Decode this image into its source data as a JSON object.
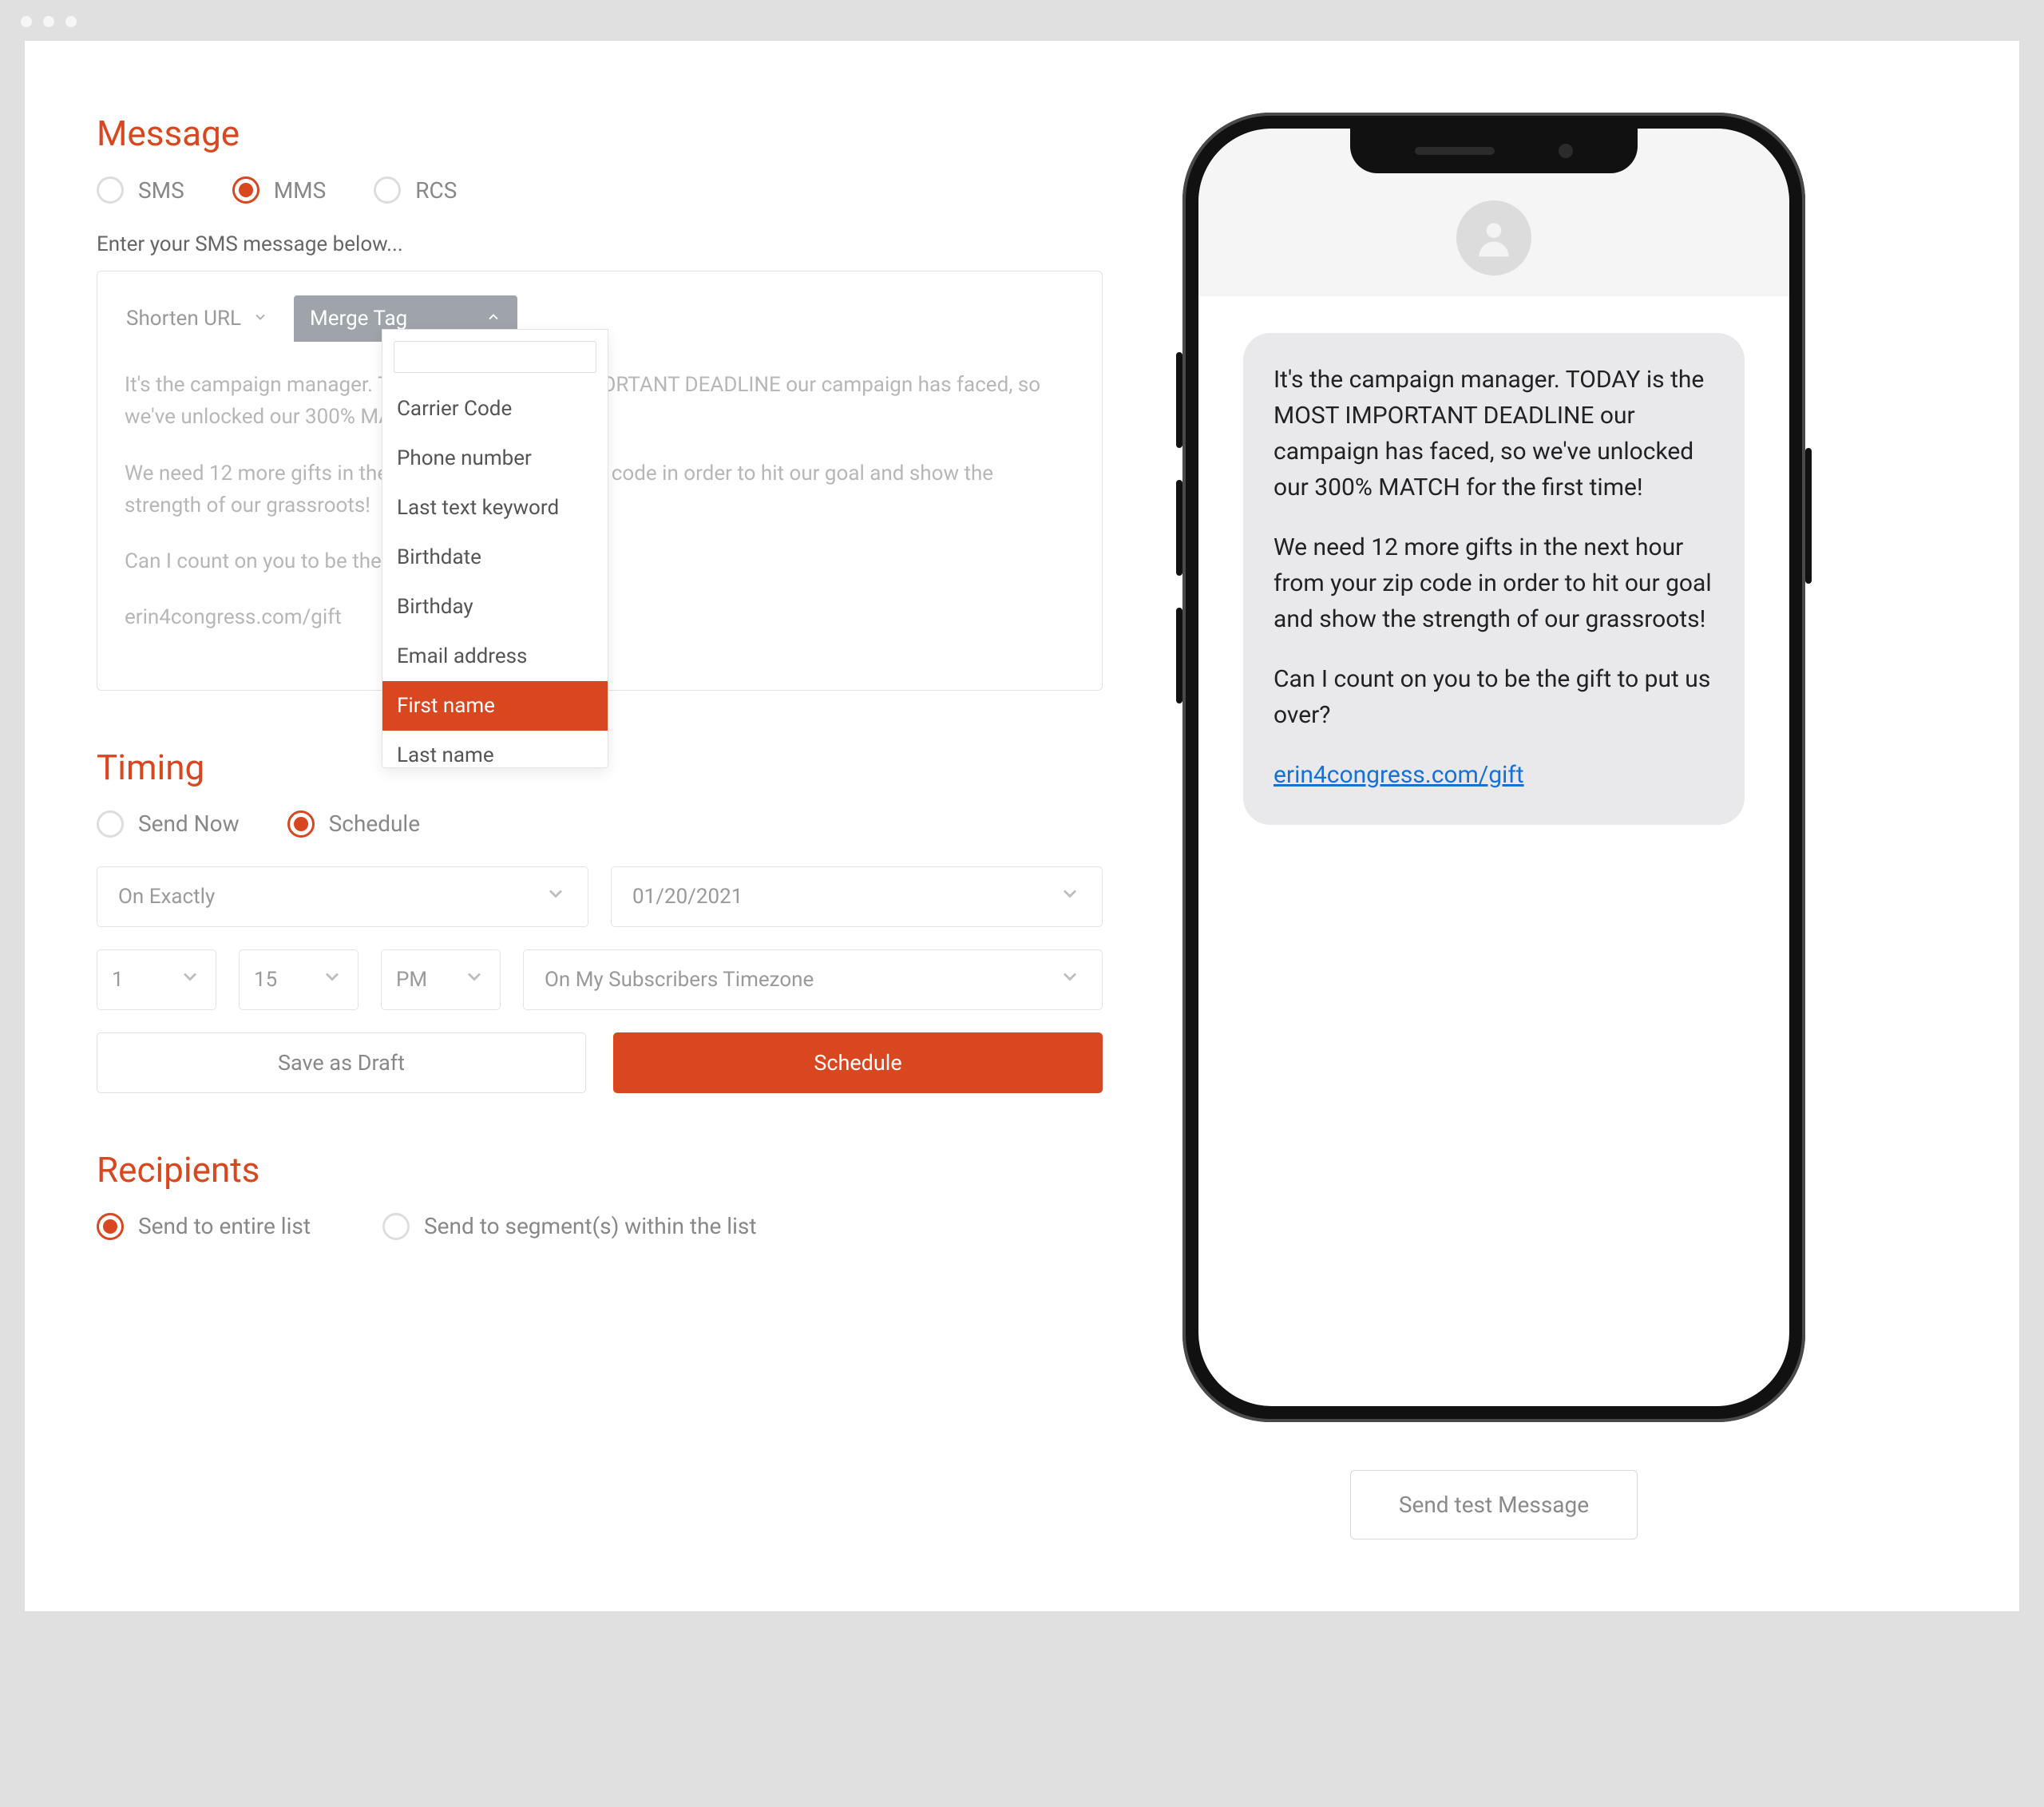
{
  "sections": {
    "message": "Message",
    "timing": "Timing",
    "recipients": "Recipients"
  },
  "message_type": {
    "options": {
      "sms": "SMS",
      "mms": "MMS",
      "rcs": "RCS"
    },
    "selected": "mms"
  },
  "compose": {
    "hint": "Enter your SMS message below...",
    "shorten_url_label": "Shorten URL",
    "merge_tag_label": "Merge Tag",
    "body": {
      "p1": "It's the campaign manager. TODAY is the MOST IMPORTANT DEADLINE our campaign has faced, so we've unlocked our 300% MATCH for the first time!",
      "p2": "We need 12 more gifts in the next hour from your zip code in order to hit our goal and show the strength of our grassroots!",
      "p3": "Can I count on you to be the gift to put us over?",
      "link_text": "erin4congress.com/gift"
    },
    "merge_tags": {
      "search_value": "",
      "options": [
        "Carrier Code",
        "Phone number",
        "Last text keyword",
        "Birthdate",
        "Birthday",
        "Email address",
        "First name",
        "Last name"
      ],
      "highlighted_index": 6
    }
  },
  "timing": {
    "options": {
      "now": "Send Now",
      "schedule": "Schedule"
    },
    "selected": "schedule",
    "mode": "On Exactly",
    "date": "01/20/2021",
    "hour": "1",
    "minute": "15",
    "ampm": "PM",
    "tz": "On My Subscribers Timezone",
    "save_draft": "Save as Draft",
    "schedule_btn": "Schedule"
  },
  "recipients": {
    "options": {
      "all": "Send to entire list",
      "segment": "Send to segment(s) within the list"
    },
    "selected": "all"
  },
  "preview": {
    "p1": "It's the campaign manager. TODAY is the MOST IMPORTANT DEADLINE our campaign has faced, so we've unlocked our 300% MATCH for the first time!",
    "p2": "We need 12 more gifts in the next hour from your zip code in order to hit our goal and show the strength of our grassroots!",
    "p3": "Can I count on you to be the gift to put us over?",
    "link_text": "erin4congress.com/gift"
  },
  "send_test": "Send test Message"
}
